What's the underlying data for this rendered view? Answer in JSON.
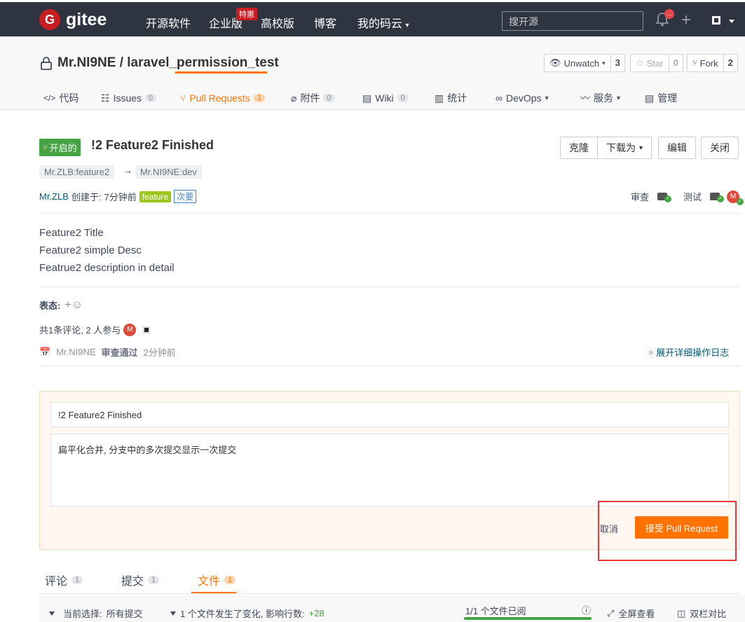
{
  "nav": {
    "brand": "gitee",
    "items": [
      "开源软件",
      "企业版",
      "高校版",
      "博客",
      "我的码云"
    ],
    "enterprise_badge": "特惠",
    "search_placeholder": "搜开源",
    "notification_count": "..."
  },
  "repo": {
    "owner": "Mr.NI9NE",
    "name": "laravel_permission_test",
    "title": "Mr.NI9NE / laravel_permission_test",
    "watch_label": "Unwatch",
    "watch_count": "3",
    "star_label": "Star",
    "star_count": "0",
    "fork_label": "Fork",
    "fork_count": "2",
    "tabs": [
      {
        "label": "代码",
        "count": ""
      },
      {
        "label": "Issues",
        "count": "0"
      },
      {
        "label": "Pull Requests",
        "count": "1"
      },
      {
        "label": "附件",
        "count": "0"
      },
      {
        "label": "Wiki",
        "count": "0"
      },
      {
        "label": "统计",
        "count": ""
      },
      {
        "label": "DevOps",
        "count": ""
      },
      {
        "label": "服务",
        "count": ""
      },
      {
        "label": "管理",
        "count": ""
      }
    ]
  },
  "pr": {
    "status": "开启的",
    "title": "!2 Feature2 Finished",
    "actions": {
      "clone": "克隆",
      "download": "下载为",
      "edit": "编辑",
      "close": "关闭"
    },
    "source_branch": "Mr.ZLB:feature2",
    "arrow": "→",
    "target_branch": "Mr.NI9NE:dev",
    "author": "Mr.ZLB",
    "created_prefix": "创建于:",
    "created_time": "7分钟前",
    "label_feature": "feature",
    "label_minor": "次要",
    "reviewer_label": "审查",
    "tester_label": "测试",
    "description": [
      "Feature2 Title",
      "Feature2 simple Desc",
      "Featrue2 description in detail"
    ],
    "reaction_label": "表态:",
    "participants_text": "共1条评论, 2 人参与",
    "event_user": "Mr.NI9NE",
    "event_action": "审查通过",
    "event_time": "2分钟前",
    "expand_log": "展开详细操作日志"
  },
  "merge": {
    "title_value": "!2 Feature2 Finished",
    "message_value": "扁平化合并, 分支中的多次提交显示一次提交",
    "cancel_label": "取消",
    "accept_label": "接受 Pull Request"
  },
  "bottom_tabs": [
    {
      "label": "评论",
      "count": "1"
    },
    {
      "label": "提交",
      "count": "1"
    },
    {
      "label": "文件",
      "count": "1"
    }
  ],
  "filebar": {
    "select_label": "当前选择:",
    "select_value": "所有提交",
    "changes_text": "1 个文件发生了变化, 影响行数:",
    "lines_added": "+28",
    "viewed_text": "1/1 个文件已阅",
    "viewed_fraction": 1.0,
    "fullscreen": "全屏查看",
    "split_view": "双栏对比"
  },
  "colors": {
    "accent": "#fe7300",
    "nav_bg": "#2e3440",
    "brand_red": "#c71d23",
    "open_green": "#45a341"
  }
}
